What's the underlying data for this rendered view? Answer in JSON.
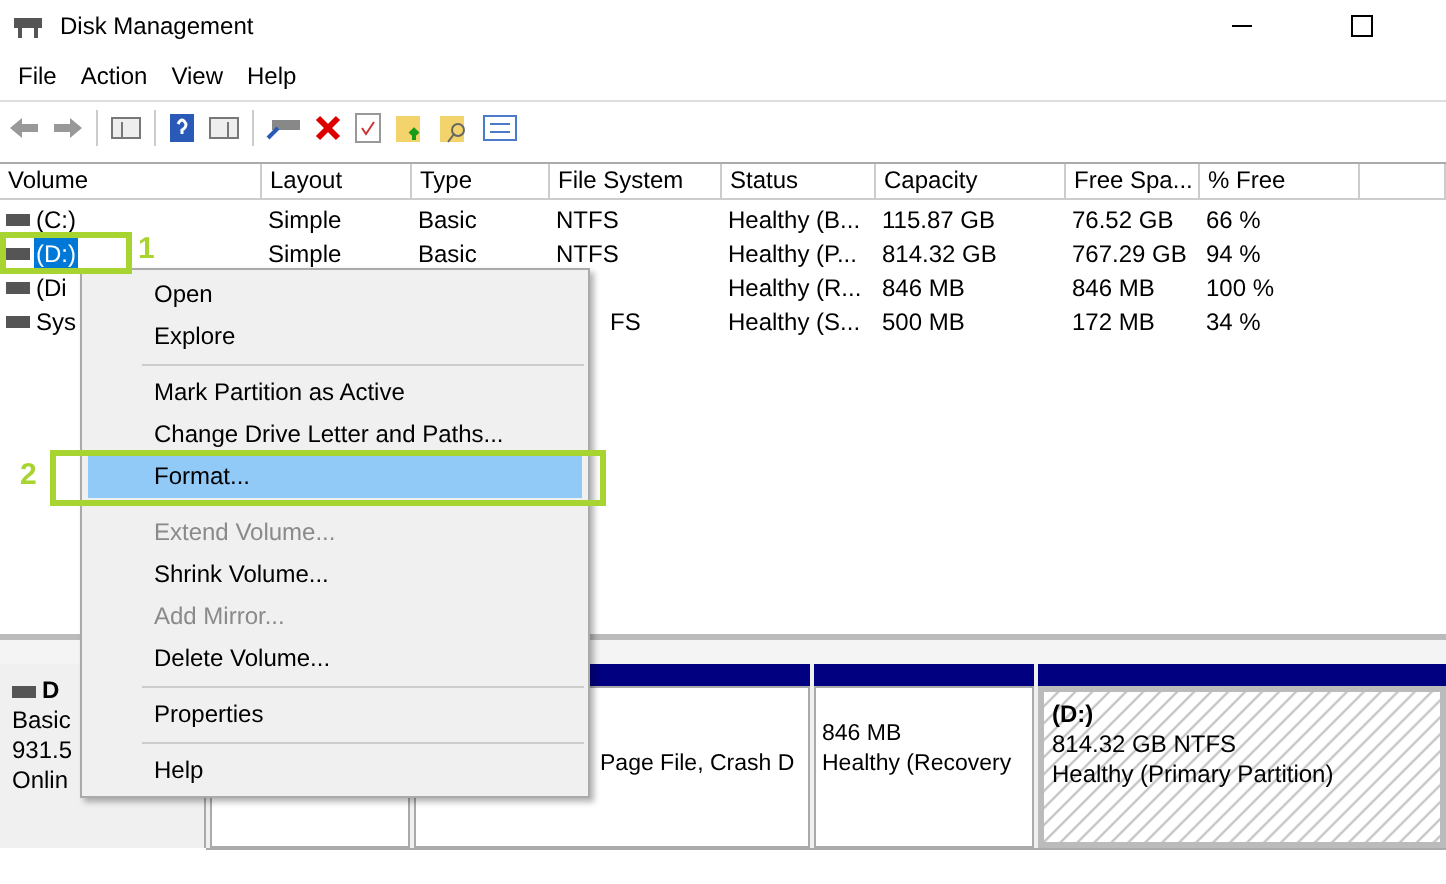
{
  "window": {
    "title": "Disk Management"
  },
  "menu_bar": [
    "File",
    "Action",
    "View",
    "Help"
  ],
  "table": {
    "columns": [
      "Volume",
      "Layout",
      "Type",
      "File System",
      "Status",
      "Capacity",
      "Free Spa...",
      "% Free"
    ],
    "rows": [
      {
        "selected": false,
        "volume": "(C:)",
        "layout": "Simple",
        "type": "Basic",
        "file_system": "NTFS",
        "status": "Healthy (B...",
        "capacity": "115.87 GB",
        "free": "76.52 GB",
        "pct": "66 %"
      },
      {
        "selected": true,
        "volume": "(D:)",
        "layout": "Simple",
        "type": "Basic",
        "file_system": "NTFS",
        "status": "Healthy (P...",
        "capacity": "814.32 GB",
        "free": "767.29 GB",
        "pct": "94 %"
      },
      {
        "selected": false,
        "volume": "(Di",
        "status": "Healthy (R...",
        "capacity": "846 MB",
        "free": "846 MB",
        "pct": "100 %"
      },
      {
        "selected": false,
        "volume": "Sys",
        "file_system": "FS",
        "status": "Healthy (S...",
        "capacity": "500 MB",
        "free": "172 MB",
        "pct": "34 %"
      }
    ]
  },
  "disk": {
    "name": "D",
    "type": "Basic",
    "size": "931.5",
    "state": "Onlin",
    "partitions": [
      {
        "kind": "plain"
      },
      {
        "kind": "plain",
        "bar": true,
        "lines": [
          "Page File, Crash D"
        ]
      },
      {
        "kind": "plain",
        "bar": true,
        "lines": [
          "846 MB",
          "Healthy (Recovery"
        ]
      },
      {
        "kind": "hatched",
        "bar": true,
        "title": "(D:)",
        "lines": [
          "814.32 GB NTFS",
          "Healthy (Primary Partition)"
        ]
      }
    ]
  },
  "context_menu": [
    {
      "kind": "item",
      "label": "Open",
      "disabled": false,
      "selected": false
    },
    {
      "kind": "item",
      "label": "Explore",
      "disabled": false,
      "selected": false
    },
    {
      "kind": "separator"
    },
    {
      "kind": "item",
      "label": "Mark Partition as Active",
      "disabled": false,
      "selected": false
    },
    {
      "kind": "item",
      "label": "Change Drive Letter and Paths...",
      "disabled": false,
      "selected": false
    },
    {
      "kind": "item",
      "label": "Format...",
      "disabled": false,
      "selected": true
    },
    {
      "kind": "separator"
    },
    {
      "kind": "item",
      "label": "Extend Volume...",
      "disabled": true,
      "selected": false
    },
    {
      "kind": "item",
      "label": "Shrink Volume...",
      "disabled": false,
      "selected": false
    },
    {
      "kind": "item",
      "label": "Add Mirror...",
      "disabled": true,
      "selected": false
    },
    {
      "kind": "item",
      "label": "Delete Volume...",
      "disabled": false,
      "selected": false
    },
    {
      "kind": "separator"
    },
    {
      "kind": "item",
      "label": "Properties",
      "disabled": false,
      "selected": false
    },
    {
      "kind": "separator"
    },
    {
      "kind": "item",
      "label": "Help",
      "disabled": false,
      "selected": false
    }
  ],
  "annotations": [
    {
      "number": "1"
    },
    {
      "number": "2"
    }
  ]
}
